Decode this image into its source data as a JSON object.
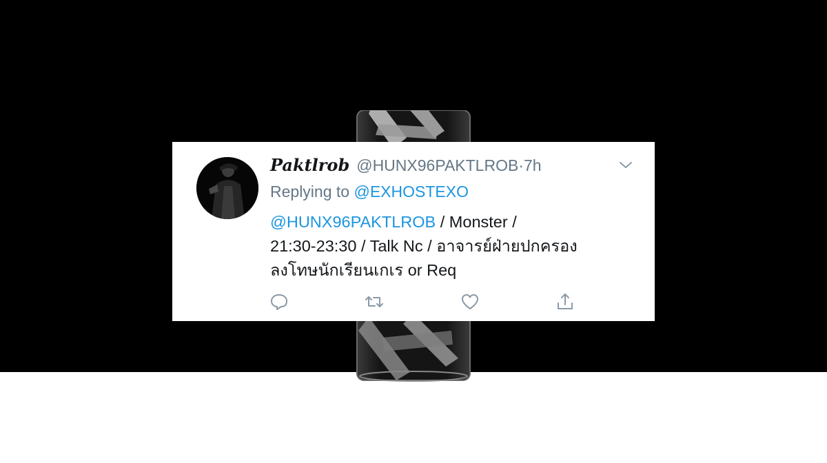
{
  "tweet": {
    "display_name": "Paktlrob",
    "handle": "@HUNX96PAKTLROB",
    "separator": "·",
    "time": "7h",
    "replying_prefix": "Replying to",
    "replying_to": "@EXHOSTEXO",
    "mention": "@HUNX96PAKTLROB",
    "line1_rest": " / Monster /",
    "line2": "21:30-23:30 / Talk Nc / อาจารย์ฝ่ายปกครอง",
    "line3": "ลงโทษนักเรียนเกเร or Req"
  },
  "actions": {
    "icons": [
      "reply-icon",
      "retweet-icon",
      "like-icon",
      "share-icon"
    ]
  },
  "colors": {
    "link": "#1b95e0",
    "muted": "#657786",
    "text": "#14171a",
    "card_bg": "#ffffff",
    "background_top": "#000000",
    "background_bottom": "#ffffff"
  }
}
